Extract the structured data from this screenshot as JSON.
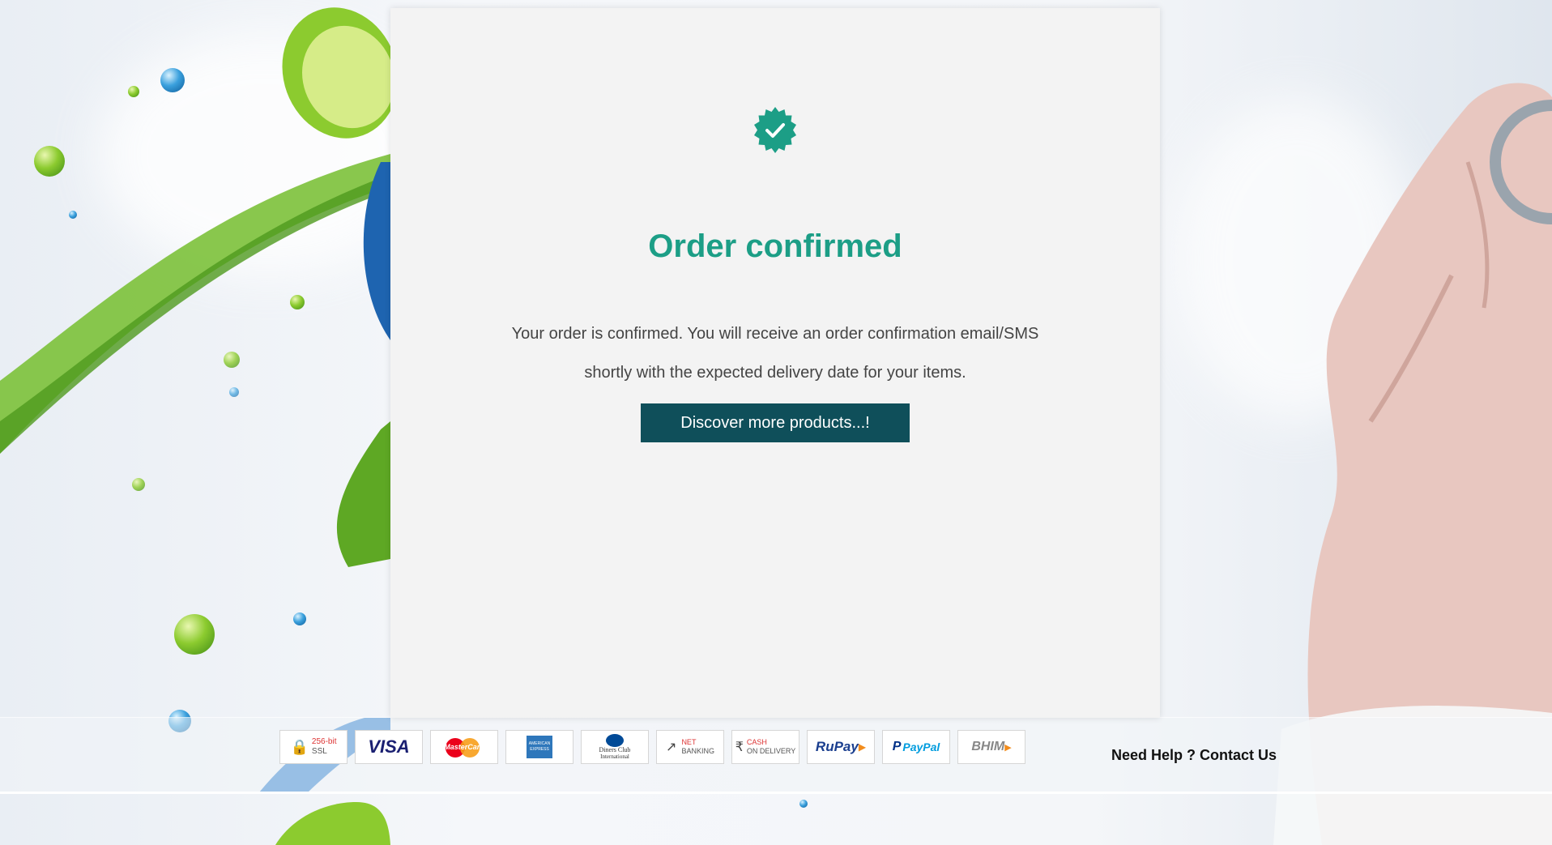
{
  "confirmation": {
    "title": "Order confirmed",
    "message_line1": "Your order is confirmed. You will receive an order confirmation email/SMS",
    "message_line2": "shortly with the expected delivery date for your items.",
    "button_label": "Discover more products...!",
    "accent_color": "#1c9e86",
    "button_color": "#0f4f5a"
  },
  "payment_methods": [
    {
      "id": "ssl",
      "line1": "256-bit",
      "line2": "SSL"
    },
    {
      "id": "visa",
      "line1": "VISA"
    },
    {
      "id": "mastercard",
      "line1": "MasterCard"
    },
    {
      "id": "amex",
      "line1": "AMERICAN EXPRESS"
    },
    {
      "id": "diners",
      "line1": "Diners Club",
      "line2": "International"
    },
    {
      "id": "netbanking",
      "line1": "NET",
      "line2": "BANKING"
    },
    {
      "id": "cod",
      "line1": "CASH",
      "line2": "ON DELIVERY"
    },
    {
      "id": "rupay",
      "line1": "RuPay"
    },
    {
      "id": "paypal",
      "line1": "PayPal"
    },
    {
      "id": "bhim",
      "line1": "BHIM"
    }
  ],
  "footer": {
    "help_text": "Need Help ?",
    "contact_link": "Contact Us"
  }
}
